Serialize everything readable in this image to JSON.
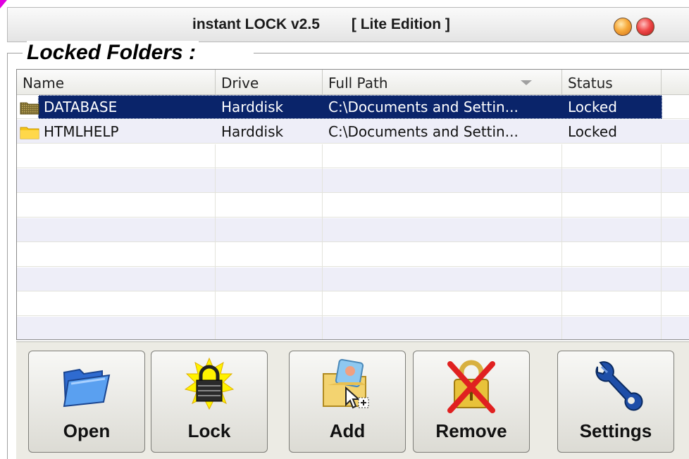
{
  "window": {
    "title": "instant LOCK v2.5",
    "edition": "[ Lite Edition ]"
  },
  "group": {
    "title": "Locked Folders :"
  },
  "table": {
    "columns": [
      "Name",
      "Drive",
      "Full Path",
      "Status"
    ],
    "rows": [
      {
        "name": "DATABASE",
        "drive": "Harddisk",
        "path": "C:\\Documents and Settin...",
        "status": "Locked"
      },
      {
        "name": "HTMLHELP",
        "drive": "Harddisk",
        "path": "C:\\Documents and Settin...",
        "status": "Locked"
      }
    ]
  },
  "toolbar": {
    "open": "Open",
    "lock": "Lock",
    "add": "Add",
    "remove": "Remove",
    "settings": "Settings"
  },
  "icons": {
    "min": "minimize-icon",
    "close": "close-icon",
    "folder": "folder-icon",
    "open": "open-folder-icon",
    "lock": "padlock-icon",
    "add": "add-folder-icon",
    "remove": "remove-lock-icon",
    "settings": "wrench-icon"
  },
  "colors": {
    "selection": "#0a246a",
    "altRow": "#eeeef8",
    "folderYellow": "#f5c518"
  }
}
